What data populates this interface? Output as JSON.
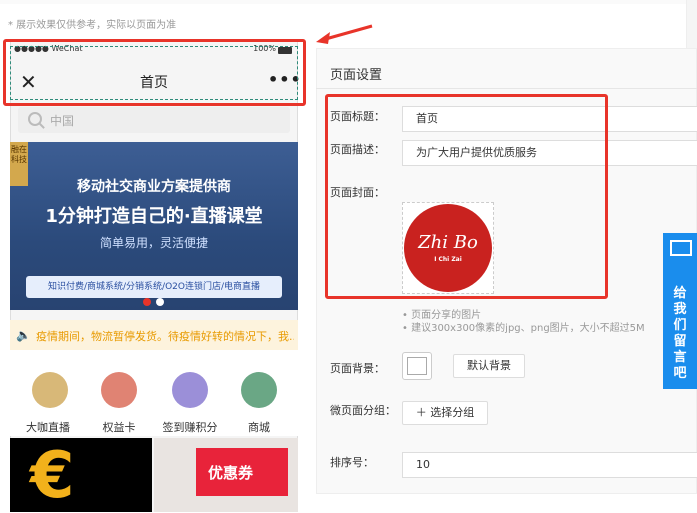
{
  "note": "* 展示效果仅供参考，实际以页面为准",
  "phone": {
    "status_carrier": "●●●●● WeChat",
    "status_battery": "100%",
    "close_glyph": "✕",
    "nav_title": "首页",
    "more_glyph": "•••",
    "search_placeholder": "中国"
  },
  "banner": {
    "tag": "融在科技",
    "line1": "移动社交商业方案提供商",
    "line2": "1分钟打造自己的·直播课堂",
    "line3": "简单易用，灵活便捷",
    "line4": "知识付费/商城系统/分销系统/O2O连锁门店/电商直播"
  },
  "notice": "疫情期间，物流暂停发货。待疫情好转的情况下，我...",
  "grid_items": [
    {
      "label": "大咖直播",
      "color": "#d8b878"
    },
    {
      "label": "权益卡",
      "color": "#e08373"
    },
    {
      "label": "签到赚积分",
      "color": "#9b8fd8"
    },
    {
      "label": "商城",
      "color": "#6aa785"
    }
  ],
  "coupon_text": "优惠券",
  "euro_glyph": "€",
  "settings": {
    "title": "页面设置",
    "page_title_label": "页面标题：",
    "page_title_value": "首页",
    "page_desc_label": "页面描述：",
    "page_desc_value": "为广大用户提供优质服务",
    "page_cover_label": "页面封面：",
    "cover_logo_script": "Zhi Bo",
    "cover_logo_sub": "I Chi Zai",
    "hint1": "• 页面分享的图片",
    "hint2": "• 建议300x300像素的jpg、png图片，大小不超过5M",
    "bg_label": "页面背景：",
    "default_bg_button": "默认背景",
    "group_label": "微页面分组：",
    "select_group_button": "＋ 选择分组",
    "sort_label": "排序号：",
    "sort_value": "10"
  },
  "side_tab": "给我们留言吧",
  "colors": {
    "highlight_red": "#e8342a",
    "accent_blue": "#1a8ded"
  }
}
